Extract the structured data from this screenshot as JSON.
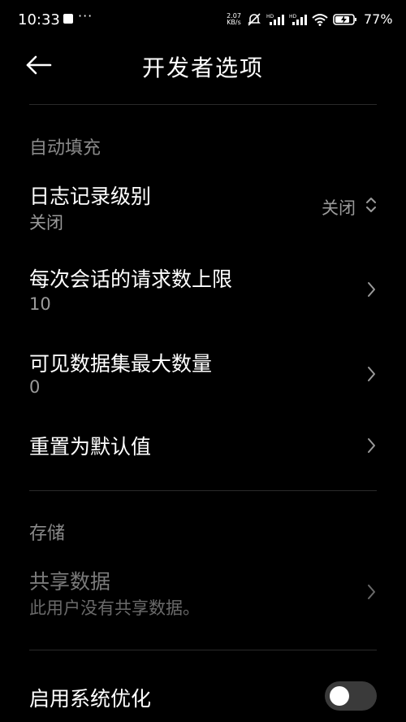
{
  "status_bar": {
    "time": "10:33",
    "more": "···",
    "speed_value": "2.07",
    "speed_unit": "KB/s",
    "battery": "77%"
  },
  "header": {
    "title": "开发者选项"
  },
  "autofill": {
    "section_label": "自动填充",
    "log_level": {
      "title": "日志记录级别",
      "value": "关闭",
      "right_value": "关闭"
    },
    "max_requests": {
      "title": "每次会话的请求数上限",
      "value": "10"
    },
    "max_datasets": {
      "title": "可见数据集最大数量",
      "value": "0"
    },
    "reset": {
      "title": "重置为默认值"
    }
  },
  "storage": {
    "section_label": "存储",
    "shared_data": {
      "title": "共享数据",
      "subtitle": "此用户没有共享数据。"
    }
  },
  "system": {
    "optimize": {
      "title": "启用系统优化",
      "enabled": false
    }
  }
}
